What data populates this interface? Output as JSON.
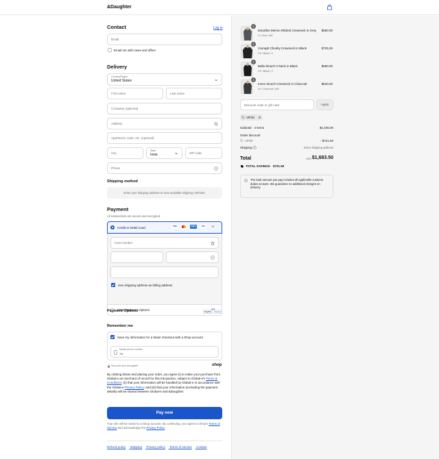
{
  "header": {
    "brand": "&Daughter"
  },
  "contact": {
    "title": "Contact",
    "login": "Log in",
    "email_placeholder": "Email",
    "news_label": "Email me with news and offers"
  },
  "delivery": {
    "title": "Delivery",
    "country_label": "Country/Region",
    "country_value": "United States",
    "first_name": "First name",
    "last_name": "Last name",
    "company": "Company (optional)",
    "address": "Address",
    "apartment": "Apartment, suite, etc. (optional)",
    "city": "City",
    "state_label": "State",
    "state_value": "Iowa",
    "zip": "ZIP code",
    "phone": "Phone"
  },
  "shipping_method": {
    "title": "Shipping method",
    "message": "Enter your shipping address to view available shipping methods."
  },
  "payment": {
    "title": "Payment",
    "subtitle": "All transactions are secure and encrypted.",
    "credit_label": "Credit or Debit Card",
    "card_logos": [
      "VISA",
      "MC",
      "AMEX",
      "JCB",
      "+3"
    ],
    "card_number": "Card number",
    "billing_label": "Use shipping address as billing address",
    "more_options": "More Payment Options",
    "more_dots": "•••",
    "options_title": "Payment Options",
    "option_logos": [
      "PayPal",
      "Venmo"
    ]
  },
  "remember": {
    "title": "Remember me",
    "save_label": "Save my information for a faster checkout with a Shop account",
    "mobile_label": "Mobile phone number",
    "mobile_value": "+1",
    "secure": "Secured and encrypted",
    "shop": "shop"
  },
  "legal": {
    "p1": "By clicking below and placing your order, you agree (i) to make your purchase from Global-e as merchant of record for this transaction, subject to Global-e's ",
    "terms": "Terms & Conditions",
    "p2": "; (ii) that your information will be handled by Global-e in accordance with the Global-e ",
    "privacy": "Privacy Policy",
    "p3": "; and (iii) that your information (excluding the payment details) will be shared between Global-e and &Daughter."
  },
  "pay_button": "Pay now",
  "shop_note": {
    "p1": "Your info will be saved to a Shop account. By continuing, you agree to Shop's ",
    "terms": "Terms of Service",
    "p2": " and acknowledge the ",
    "privacy": "Privacy Policy",
    "p3": "."
  },
  "footer_links": [
    "Refund policy",
    "Shipping",
    "Privacy policy",
    "Terms of service",
    "Contact"
  ],
  "cart": {
    "items": [
      {
        "qty": "1",
        "name": "Extrafine Merino Ribbed Crewneck in Grey",
        "variant": "S / Grey / AW",
        "price": "$580.00"
      },
      {
        "qty": "1",
        "name": "Carragh Chunky Crewneck in Black",
        "variant": "XS / Black / C",
        "price": "$725.00"
      },
      {
        "qty": "1",
        "name": "Balla Slouch V-Neck in Black",
        "variant": "XS / Black / C",
        "price": "$580.00"
      },
      {
        "qty": "1",
        "name": "Innes Slouch Crewneck in Charcoal",
        "variant": "XS / Charcoal / AW",
        "price": "$520.00"
      }
    ],
    "discount_placeholder": "Discount code or gift card",
    "apply": "Apply",
    "applied_code": "VIP30",
    "subtotal_label": "Subtotal · 4 items",
    "subtotal_value": "$2,405.00",
    "order_discount_label": "Order discount",
    "discount_code": "VIP30",
    "discount_value": "- $721.50",
    "shipping_label": "Shipping",
    "shipping_value": "Enter shipping address",
    "total_label": "Total",
    "currency": "USD",
    "total_value": "$1,683.50",
    "savings_label": "TOTAL SAVINGS",
    "savings_value": "$721.50",
    "duties_note": "The total amount you pay includes all applicable customs duties & taxes. We guarantee no additional charges on delivery."
  },
  "colors": {
    "accent": "#1a55c9",
    "sidebar_bg": "#f5f5f5"
  }
}
